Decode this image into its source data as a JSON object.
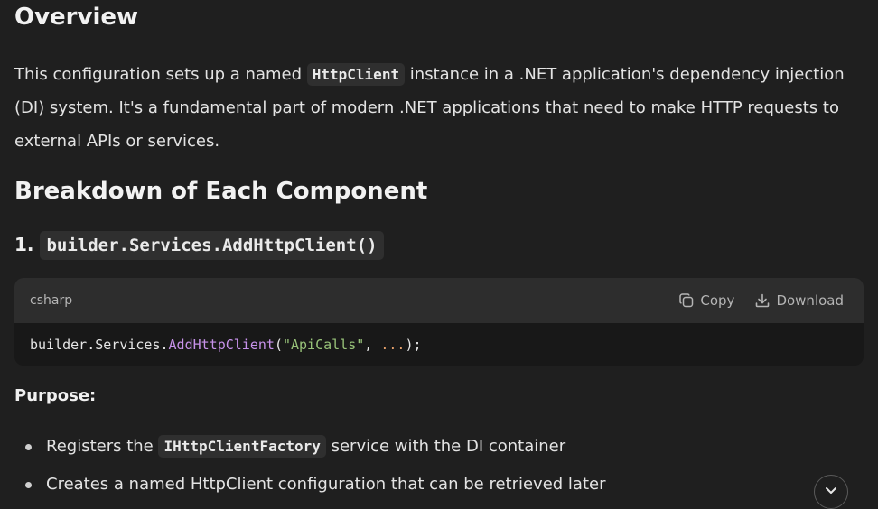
{
  "overview": {
    "heading": "Overview",
    "para_before_code": "This configuration sets up a named ",
    "inline_code": "HttpClient",
    "para_after_code": " instance in a .NET application's dependency injection (DI) system. It's a fundamental part of modern .NET applications that need to make HTTP requests to external APIs or services."
  },
  "breakdown": {
    "heading": "Breakdown of Each Component",
    "item_number": "1. ",
    "item_code": "builder.Services.AddHttpClient()"
  },
  "codeblock": {
    "language": "csharp",
    "copy_label": "Copy",
    "download_label": "Download",
    "tokens": {
      "prefix": "builder.Services.",
      "fn": "AddHttpClient",
      "open": "(",
      "str": "\"ApiCalls\"",
      "comma": ", ",
      "ellipsis": "...",
      "close": ");"
    }
  },
  "purpose": {
    "heading": "Purpose:",
    "bullet1_before": "Registers the ",
    "bullet1_code": "IHttpClientFactory",
    "bullet1_after": " service with the DI container",
    "bullet2": "Creates a named HttpClient configuration that can be retrieved later"
  },
  "icons": {
    "copy": "copy-icon",
    "download": "download-icon",
    "scroll": "chevron-down-icon"
  }
}
